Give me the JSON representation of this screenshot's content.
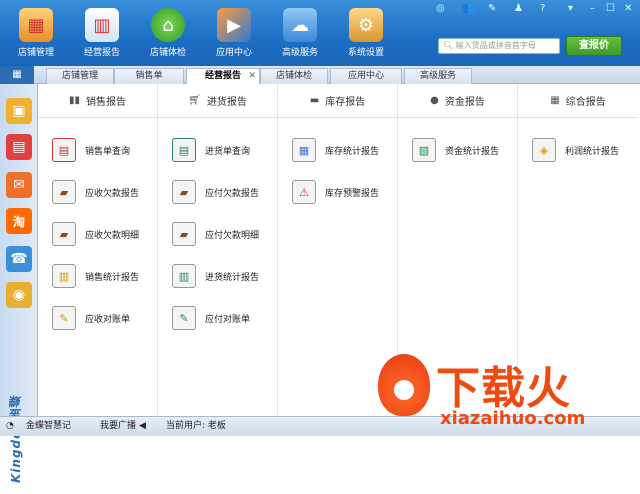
{
  "toolbar": {
    "buttons": [
      {
        "label": "店铺管理",
        "icon": "storefront-icon"
      },
      {
        "label": "经营报告",
        "icon": "report-chart-icon"
      },
      {
        "label": "店铺体检",
        "icon": "home-check-icon"
      },
      {
        "label": "应用中心",
        "icon": "app-center-icon"
      },
      {
        "label": "高级服务",
        "icon": "cloud-icon"
      },
      {
        "label": "系统设置",
        "icon": "gear-icon"
      }
    ],
    "search_placeholder": "输入货品或拼音首字母",
    "search_button": "查报价"
  },
  "tabs": [
    {
      "label": "店铺管理",
      "active": false
    },
    {
      "label": "销售单",
      "active": false
    },
    {
      "label": "经营报告",
      "active": true
    },
    {
      "label": "店铺体检",
      "active": false
    },
    {
      "label": "应用中心",
      "active": false
    },
    {
      "label": "高级服务",
      "active": false
    }
  ],
  "sidebar": {
    "brand": "Kingdee金蝶"
  },
  "columns": [
    {
      "title": "销售报告",
      "icon": "bar-chart-icon",
      "items": [
        "销售单查询",
        "应收欠款报告",
        "应收欠款明细",
        "销售统计报告",
        "应收对账单"
      ]
    },
    {
      "title": "进货报告",
      "icon": "cart-icon",
      "items": [
        "进货单查询",
        "应付欠款报告",
        "应付欠款明细",
        "进货统计报告",
        "应付对账单"
      ]
    },
    {
      "title": "库存报告",
      "icon": "inventory-icon",
      "items": [
        "库存统计报告",
        "库存预警报告"
      ]
    },
    {
      "title": "资金报告",
      "icon": "money-icon",
      "items": [
        "资金统计报告"
      ]
    },
    {
      "title": "综合报告",
      "icon": "grid-icon",
      "items": [
        "利润统计报告"
      ]
    }
  ],
  "status": {
    "app": "金蝶智慧记",
    "broadcast": "我要广播",
    "user_label": "当前用户: 老板"
  },
  "watermark": {
    "text": "下载火",
    "url": "xiazaihuo.com"
  }
}
